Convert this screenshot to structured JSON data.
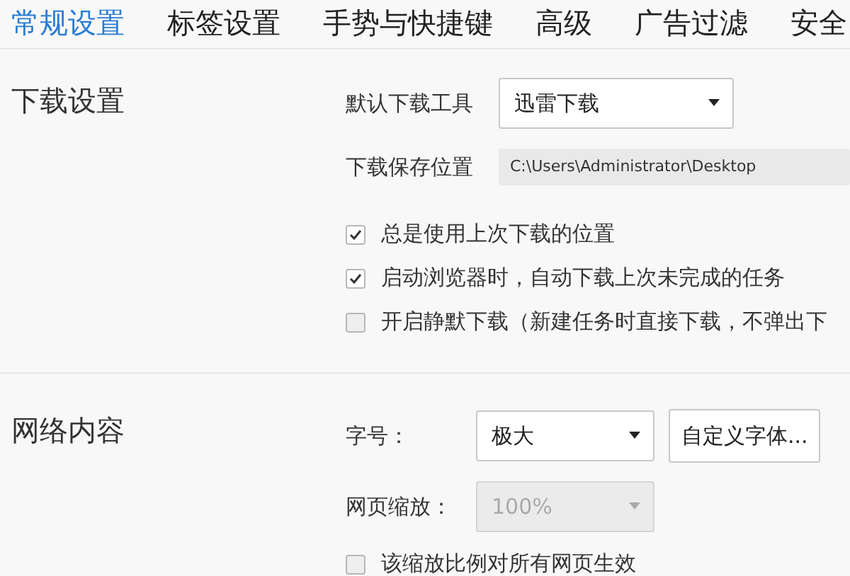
{
  "tabs": [
    {
      "label": "常规设置",
      "selected": true
    },
    {
      "label": "标签设置",
      "selected": false
    },
    {
      "label": "手势与快捷键",
      "selected": false
    },
    {
      "label": "高级",
      "selected": false
    },
    {
      "label": "广告过滤",
      "selected": false
    },
    {
      "label": "安全",
      "selected": false
    }
  ],
  "sections": [
    {
      "title": "下载设置",
      "rows": [
        {
          "kind": "select",
          "label": "默认下载工具",
          "value": "迅雷下载",
          "disabled": false
        },
        {
          "kind": "path",
          "label": "下载保存位置",
          "value": "C:\\Users\\Administrator\\Desktop"
        },
        {
          "kind": "checkbox",
          "label": "总是使用上次下载的位置",
          "checked": true
        },
        {
          "kind": "checkbox",
          "label": "启动浏览器时，自动下载上次未完成的任务",
          "checked": true
        },
        {
          "kind": "checkbox",
          "label": "开启静默下载（新建任务时直接下载，不弹出下",
          "checked": false
        }
      ]
    },
    {
      "title": "网络内容",
      "rows": [
        {
          "kind": "select",
          "label": "字号：",
          "value": "极大",
          "disabled": false,
          "button": "自定义字体..."
        },
        {
          "kind": "select",
          "label": "网页缩放：",
          "value": "100%",
          "disabled": true
        },
        {
          "kind": "checkbox",
          "label": "该缩放比例对所有网页生效",
          "checked": false
        }
      ]
    }
  ]
}
